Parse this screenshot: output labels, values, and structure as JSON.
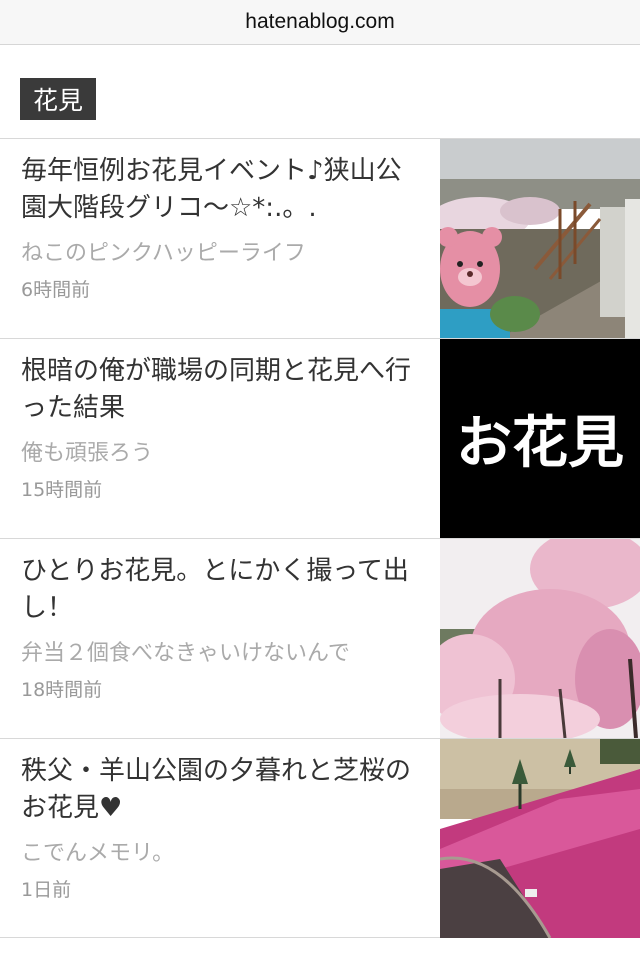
{
  "browser": {
    "url": "hatenablog.com"
  },
  "tag": {
    "label": "花見"
  },
  "entries": [
    {
      "title": "毎年恒例お花見イベント♪狭山公園大階段グリコ〜☆*:.。.",
      "blog": "ねこのピンクハッピーライフ",
      "time": "6時間前",
      "thumb": "park-stairs-teddy-bear"
    },
    {
      "title": "根暗の俺が職場の同期と花見へ行った結果",
      "blog": "俺も頑張ろう",
      "time": "15時間前",
      "thumb_text": "お花見"
    },
    {
      "title": "ひとりお花見。とにかく撮って出し！",
      "blog": "弁当２個食べなきゃいけないんで",
      "time": "18時間前",
      "thumb": "cherry-blossoms"
    },
    {
      "title": "秩父・羊山公園の夕暮れと芝桜のお花見♥",
      "blog": "こでんメモリ。",
      "time": "1日前",
      "thumb": "moss-phlox-field"
    }
  ]
}
